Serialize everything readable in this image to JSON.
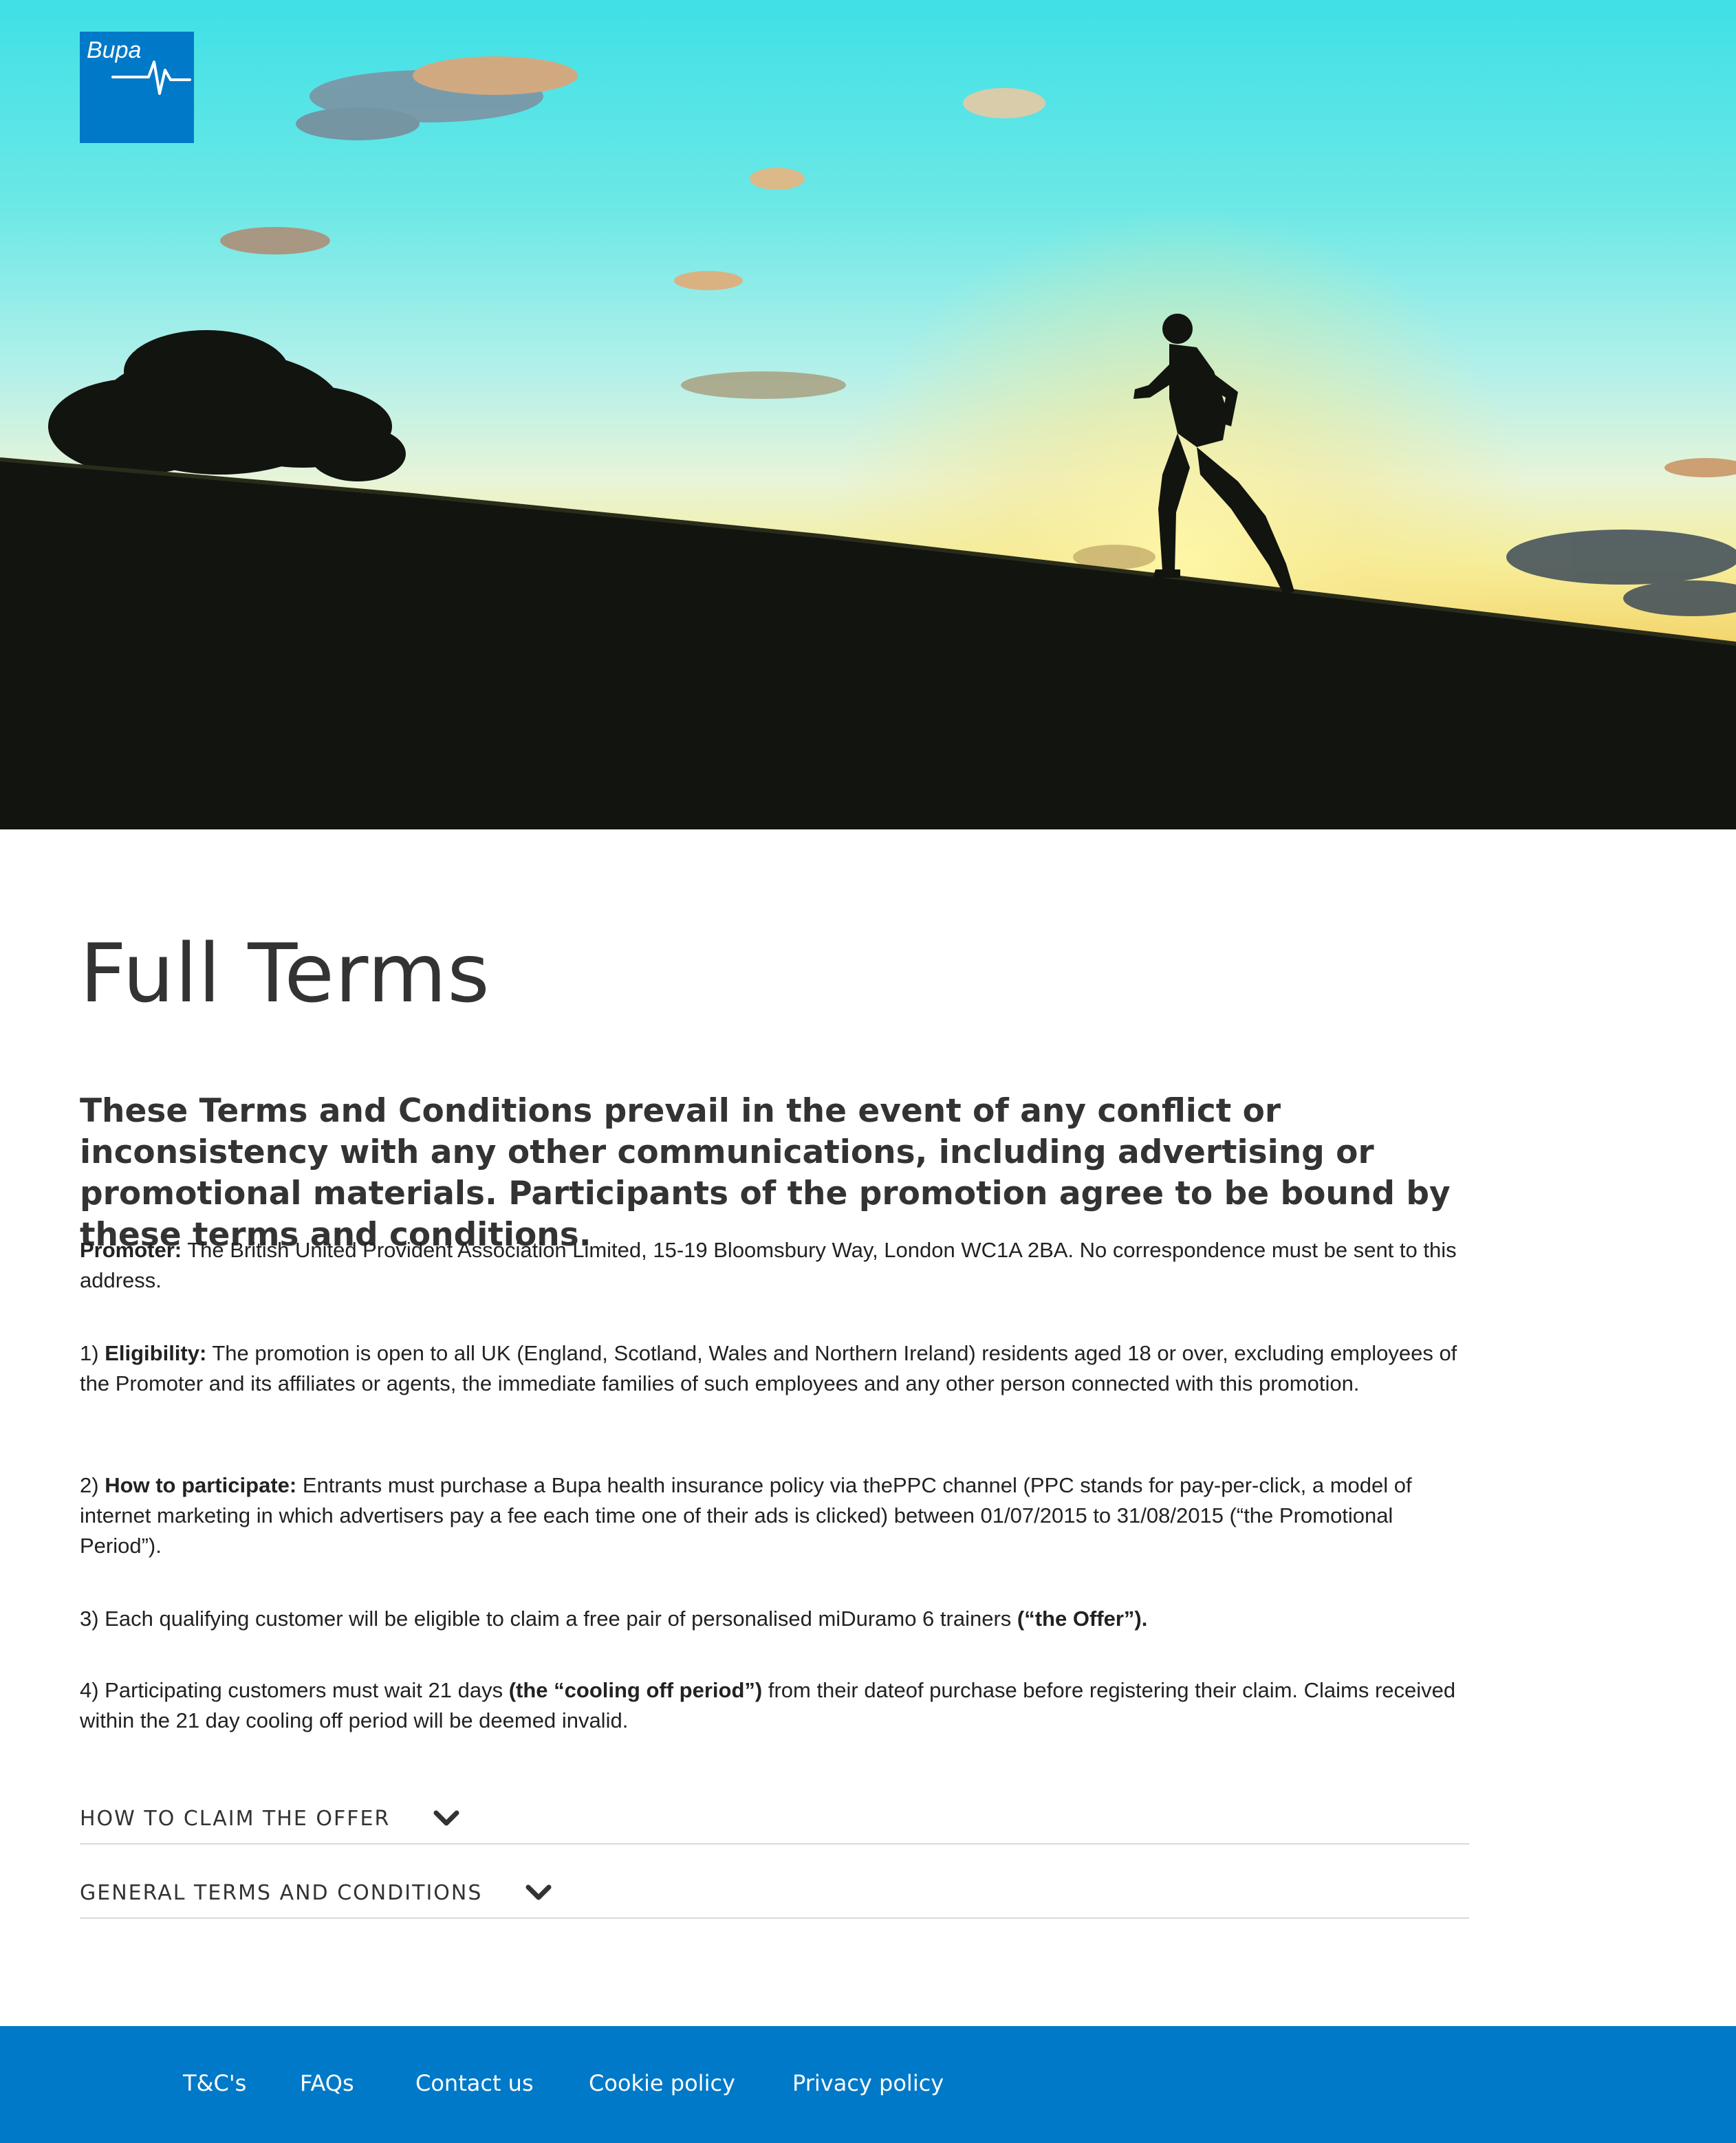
{
  "brand": {
    "logo_text": "Bupa",
    "brand_color": "#0079c8"
  },
  "page": {
    "title": "Full Terms",
    "intro": "These Terms and Conditions prevail in the event of any conflict or inconsistency with any other communications, including advertising or promotional materials. Participants of the promotion agree to be bound by these terms and conditions."
  },
  "terms": {
    "promoter": {
      "label": "Promoter:",
      "text": " The British United Provident Association Limited, 15-19 Bloomsbury Way, London WC1A 2BA. No correspondence must be sent to this address."
    },
    "item1": {
      "prefix": "1) ",
      "label": "Eligibility:",
      "text": " The promotion is open to all UK (England, Scotland, Wales and Northern Ireland) residents aged 18 or over, excluding employees of the Promoter and its affiliates or agents, the immediate families of such employees and any other person connected with this promotion."
    },
    "item2": {
      "prefix": "2) ",
      "label": "How to participate:",
      "text": " Entrants must purchase a Bupa health insurance policy via thePPC channel (PPC stands for pay-per-click, a model of internet marketing in which advertisers pay a fee each time one of their ads is clicked) between 01/07/2015 to 31/08/2015 (“the Promotional Period”)."
    },
    "item3": {
      "text": "3) Each qualifying customer will be eligible to claim a free pair of personalised miDuramo 6 trainers ",
      "bold": "(“the Offer”)."
    },
    "item4": {
      "text_before": "4) Participating customers must wait 21 days ",
      "bold": "(the “cooling off period”)",
      "text_after": " from their dateof purchase before registering their claim. Claims received within the 21 day cooling off period will be deemed invalid."
    }
  },
  "accordion": [
    {
      "label": "HOW TO CLAIM THE OFFER",
      "icon": "chevron-down-icon"
    },
    {
      "label": "GENERAL TERMS AND CONDITIONS",
      "icon": "chevron-down-icon"
    }
  ],
  "footer": {
    "links": [
      "T&C's",
      "FAQs",
      "Contact us",
      "Cookie policy",
      "Privacy policy"
    ]
  }
}
